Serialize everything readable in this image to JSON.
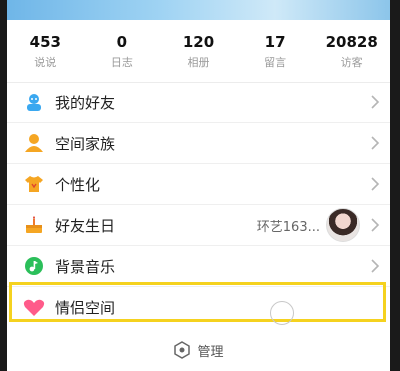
{
  "stats": [
    {
      "value": "453",
      "label": "说说"
    },
    {
      "value": "0",
      "label": "日志"
    },
    {
      "value": "120",
      "label": "相册"
    },
    {
      "value": "17",
      "label": "留言"
    },
    {
      "value": "20828",
      "label": "访客"
    }
  ],
  "menu": {
    "friends": "我的好友",
    "family": "空间家族",
    "personalize": "个性化",
    "birthday": "好友生日",
    "birthday_extra": "环艺163...",
    "music": "背景音乐",
    "couple": "情侣空间"
  },
  "footer": {
    "manage_label": "管理"
  },
  "colors": {
    "highlight": "#f5d21f",
    "friends_icon": "#3aa8f0",
    "family_icon": "#f5a623",
    "music_icon": "#2bbf5a",
    "couple_icon": "#ff5b8a"
  }
}
